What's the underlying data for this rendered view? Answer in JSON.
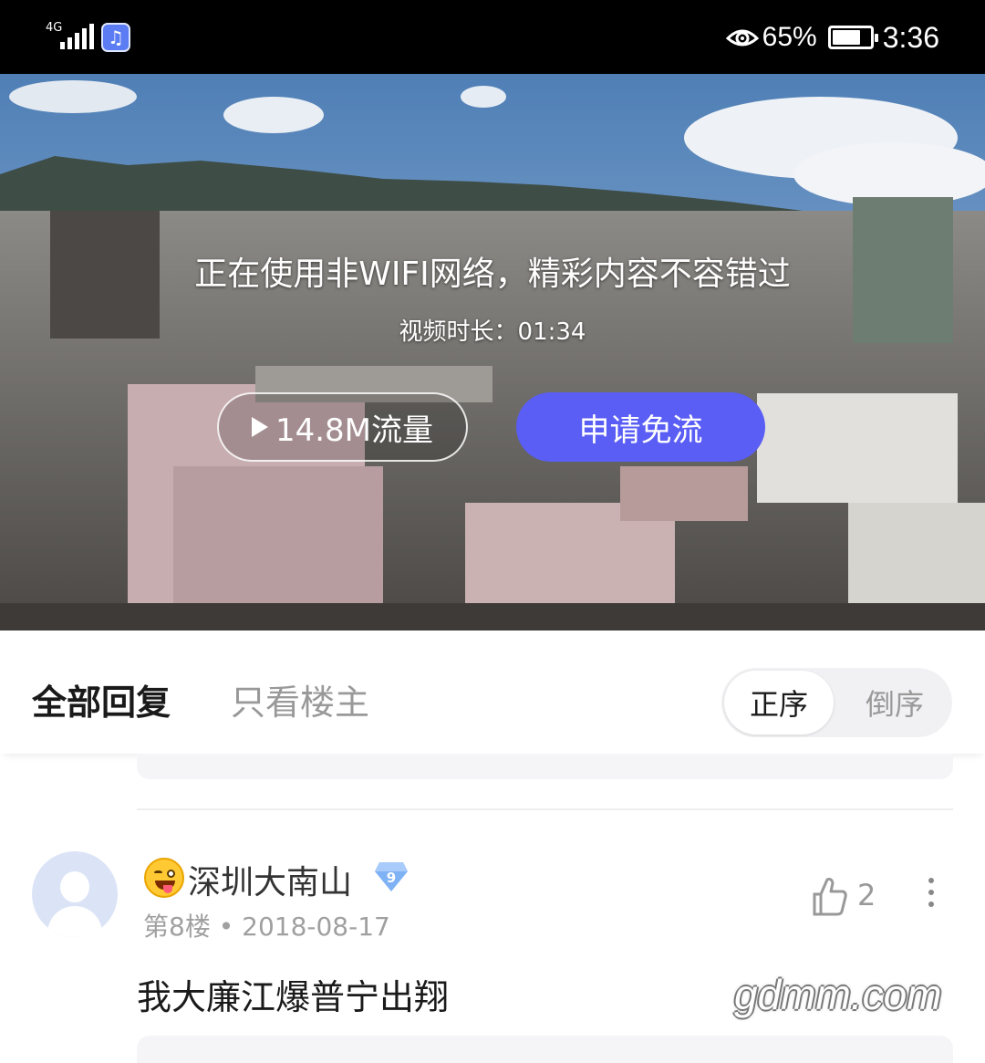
{
  "status_bar": {
    "network": "4G",
    "battery_percent": "65%",
    "time": "3:36",
    "icons": [
      "signal-icon",
      "music-app-icon",
      "eye-care-icon",
      "battery-icon"
    ]
  },
  "video": {
    "notice": "正在使用非WIFI网络，精彩内容不容错过",
    "duration": "视频时长：01:34",
    "data_button_label": "14.8M流量",
    "free_data_button_label": "申请免流",
    "accent_color": "#5a5ef5"
  },
  "reply_tabs": {
    "all_replies": "全部回复",
    "owner_only": "只看楼主",
    "sort_forward": "正序",
    "sort_reverse": "倒序"
  },
  "post": {
    "username": "深圳大南山",
    "level_badge": "9",
    "floor_and_date": "第8楼 • 2018-08-17",
    "likes": "2",
    "content": "我大廉江爆普宁出翔"
  },
  "watermark": "gdmm.com"
}
